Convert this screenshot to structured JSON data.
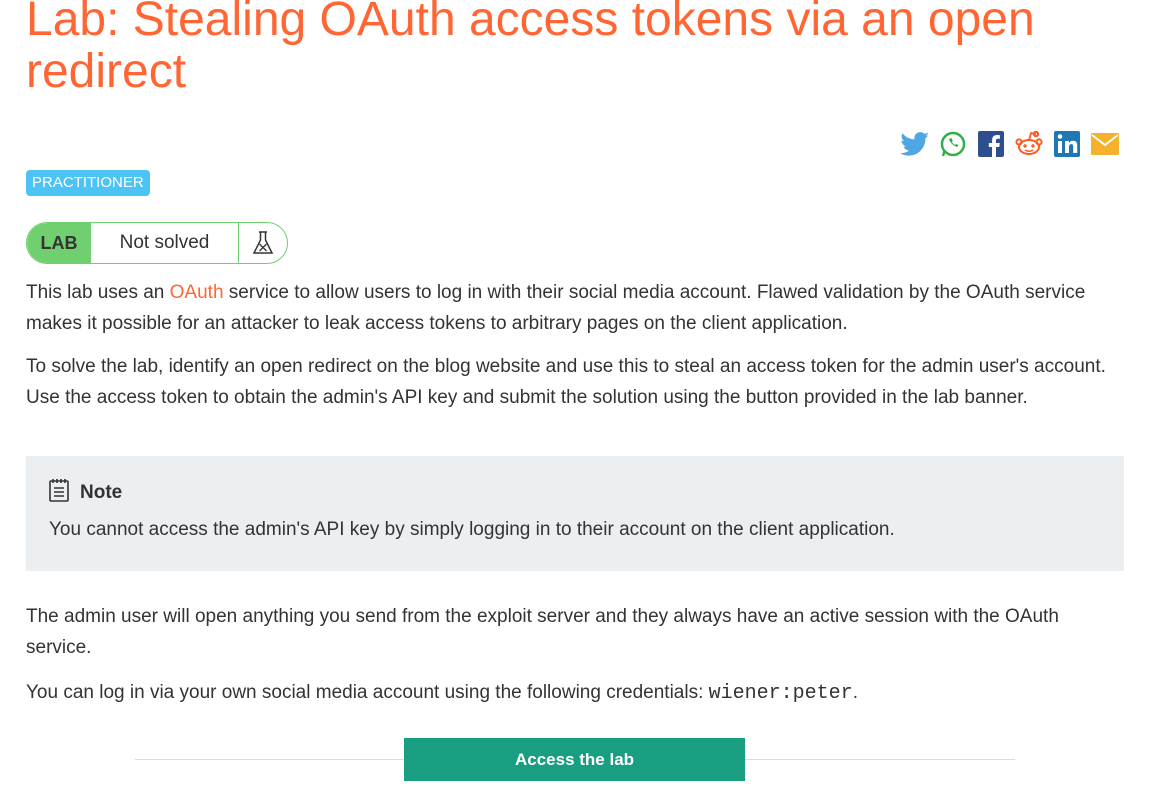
{
  "title": "Lab: Stealing OAuth access tokens via an open redirect",
  "share_icons": [
    "twitter-icon",
    "whatsapp-icon",
    "facebook-icon",
    "reddit-icon",
    "linkedin-icon",
    "email-icon"
  ],
  "level_badge": "PRACTITIONER",
  "lab_status": {
    "tag": "LAB",
    "state": "Not solved",
    "icon": "flask-icon"
  },
  "intro": {
    "before_link": "This lab uses an ",
    "link": "OAuth",
    "after_link": " service to allow users to log in with their social media account. Flawed validation by the OAuth service makes it possible for an attacker to leak access tokens to arbitrary pages on the client application."
  },
  "task": "To solve the lab, identify an open redirect on the blog website and use this to steal an access token for the admin user's account. Use the access token to obtain the admin's API key and submit the solution using the button provided in the lab banner.",
  "note": {
    "heading": "Note",
    "text": "You cannot access the admin's API key by simply logging in to their account on the client application."
  },
  "admin_info": "The admin user will open anything you send from the exploit server and they always have an active session with the OAuth service.",
  "credentials": {
    "prefix": "You can log in via your own social media account using the following credentials: ",
    "value": "wiener:peter",
    "suffix": "."
  },
  "access_button": "Access the lab",
  "colors": {
    "accent": "#ff6633",
    "badge": "#4cc3f5",
    "solved_green": "#70d070",
    "button": "#1a9e82",
    "note_bg": "#ebeff2"
  }
}
